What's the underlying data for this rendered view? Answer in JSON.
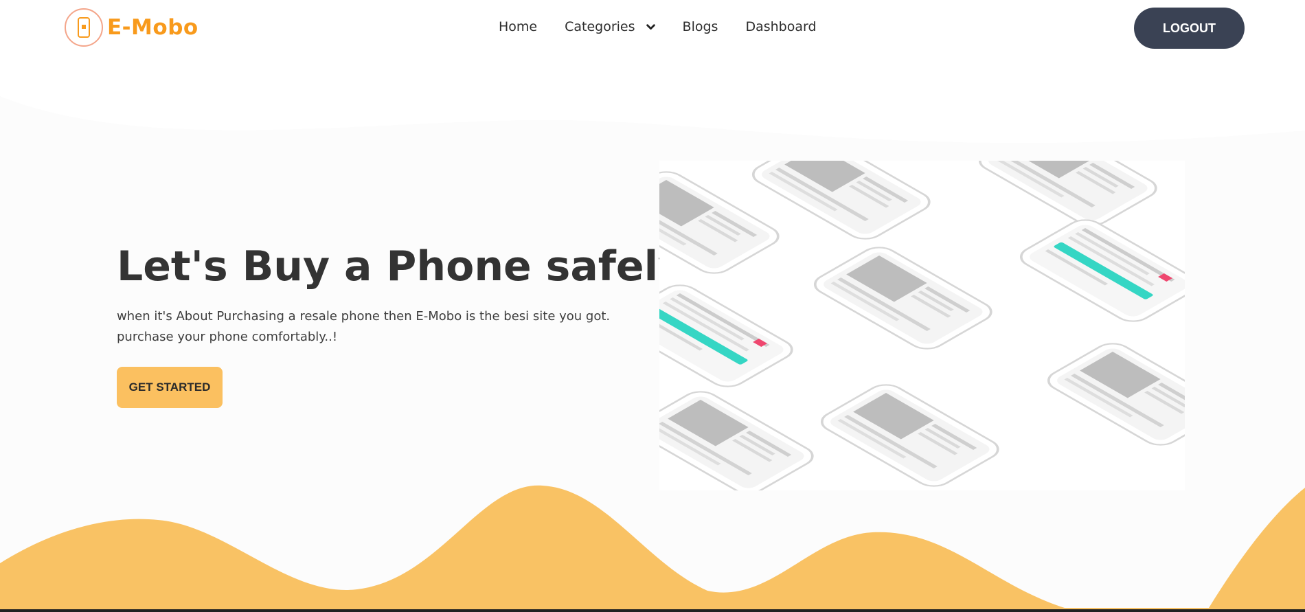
{
  "brand": {
    "name": "E-Mobo"
  },
  "nav": {
    "items": [
      {
        "label": "Home"
      },
      {
        "label": "Categories"
      },
      {
        "label": "Blogs"
      },
      {
        "label": "Dashboard"
      }
    ],
    "logout_label": "LOGOUT"
  },
  "hero": {
    "title": "Let's Buy a Phone safely!",
    "description_line1": "when it's About Purchasing a resale phone then E-Mobo is the besi site you got.",
    "description_line2": "purchase your phone comfortably..!",
    "cta_label": "GET STARTED"
  },
  "colors": {
    "accent": "#f89a1c",
    "cta": "#fbc060",
    "wave": "#f9c264",
    "logout_bg": "#3a4254"
  }
}
